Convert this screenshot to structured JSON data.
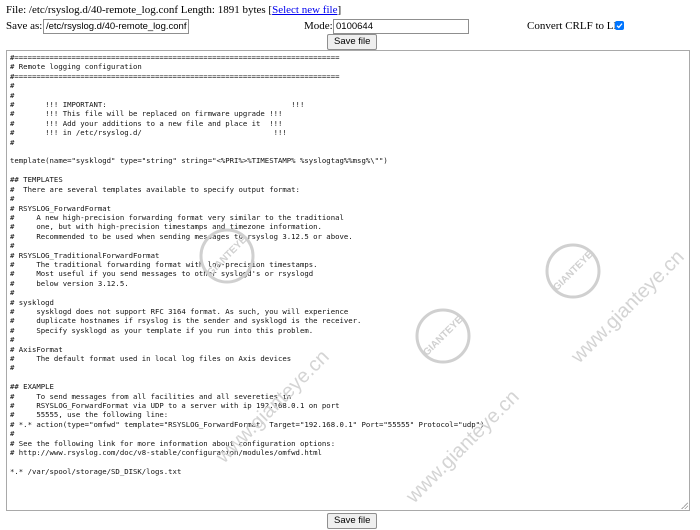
{
  "header": {
    "file_prefix": "File: /etc/rsyslog.d/40-remote_log.conf Length: 1891 bytes [",
    "select_link": "Select new file",
    "file_suffix": "]"
  },
  "form": {
    "save_as_label": "Save as:",
    "save_as_value": "/etc/rsyslog.d/40-remote_log.conf",
    "mode_label": "Mode:",
    "mode_value": "0100644",
    "crlf_label": "Convert CRLF to LF:",
    "crlf_checked": true,
    "save_button": "Save file"
  },
  "editor": {
    "content": "#==========================================================================\n# Remote logging configuration\n#==========================================================================\n#\n#\n#       !!! IMPORTANT:                                          !!!\n#       !!! This file will be replaced on firmware upgrade !!!\n#       !!! Add your additions to a new file and place it  !!!\n#       !!! in /etc/rsyslog.d/                              !!!\n#\n\ntemplate(name=\"sysklogd\" type=\"string\" string=\"<%PRI%>%TIMESTAMP% %syslogtag%%msg%\\\"\")\n\n## TEMPLATES\n#  There are several templates available to specify output format:\n#\n# RSYSLOG_ForwardFormat\n#     A new high-precision forwarding format very similar to the traditional\n#     one, but with high-precision timestamps and timezone information.\n#     Recommended to be used when sending messages to rsyslog 3.12.5 or above.\n#\n# RSYSLOG_TraditionalForwardFormat\n#     The traditional forwarding format with low-precision timestamps.\n#     Most useful if you send messages to other syslogd's or rsyslogd\n#     below version 3.12.5.\n#\n# sysklogd\n#     sysklogd does not support RFC 3164 format. As such, you will experience\n#     duplicate hostnames if rsyslog is the sender and sysklogd is the receiver.\n#     Specify sysklogd as your template if you run into this problem.\n#\n# AxisFormat\n#     The default format used in local log files on Axis devices\n#\n\n## EXAMPLE\n#     To send messages from all facilities and all severeties in\n#     RSYSLOG_ForwardFormat via UDP to a server with ip 192.168.0.1 on port\n#     55555, use the following line:\n# *.* action(type=\"omfwd\" template=\"RSYSLOG_ForwardFormat\" Target=\"192.168.0.1\" Port=\"55555\" Protocol=\"udp\")\n#\n# See the following link for more information about configuration options:\n# http://www.rsyslog.com/doc/v8-stable/configuration/modules/omfwd.html\n\n*.* /var/spool/storage/SD_DISK/logs.txt"
  },
  "watermark": {
    "badge_text": "GIANTEYE",
    "url_text": "www.gianteye.cn"
  },
  "colors": {
    "link": "#0000ee",
    "checkbox": "#0075ff",
    "watermark": "#d0d0d0"
  }
}
